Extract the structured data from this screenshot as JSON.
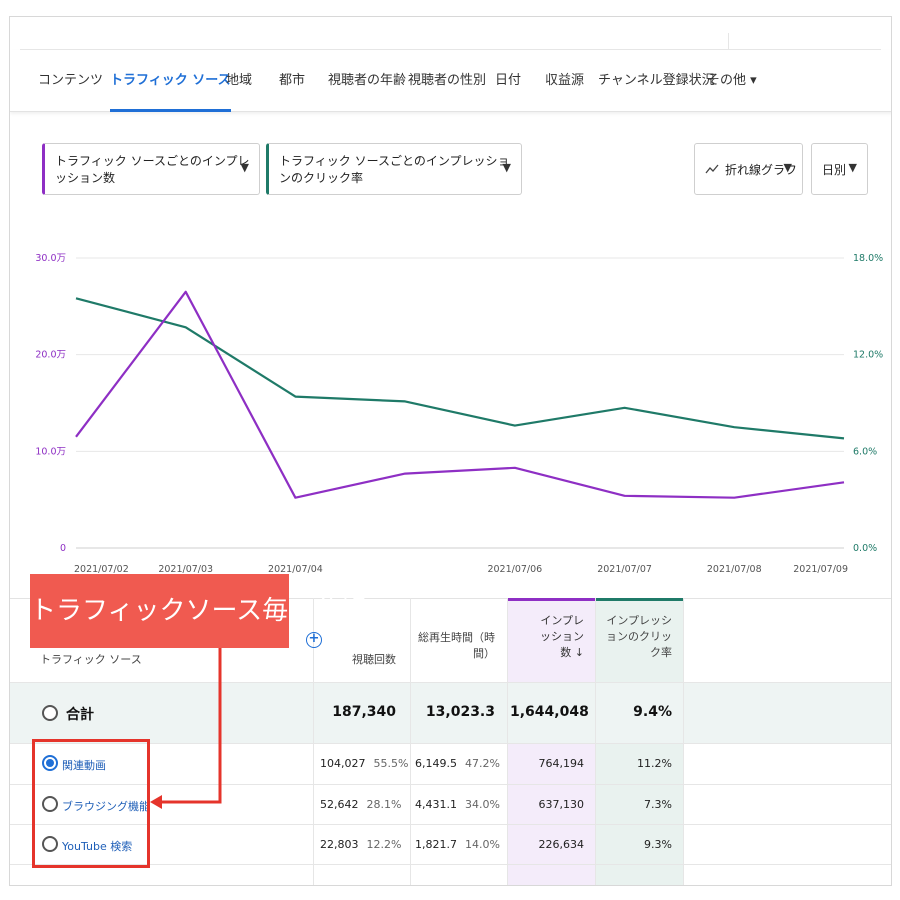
{
  "tabs": [
    {
      "label": "コンテンツ",
      "active": false
    },
    {
      "label": "トラフィック ソース",
      "active": true
    },
    {
      "label": "地域",
      "active": false
    },
    {
      "label": "都市",
      "active": false
    },
    {
      "label": "視聴者の年齢",
      "active": false
    },
    {
      "label": "視聴者の性別",
      "active": false
    },
    {
      "label": "日付",
      "active": false
    },
    {
      "label": "収益源",
      "active": false
    },
    {
      "label": "チャンネル登録状況",
      "active": false
    },
    {
      "label": "その他 ▾",
      "active": false
    }
  ],
  "selectors": {
    "metric1": "トラフィック ソースごとのインプレッション数",
    "metric2": "トラフィック ソースごとのインプレッションのクリック率",
    "chart_type": "折れ線グラフ",
    "period": "日別",
    "arrow": "▼"
  },
  "colors": {
    "series1": "#8e2fc4",
    "series2": "#1f7a68",
    "accent": "#1f6fd6",
    "annotation": "#f05a50"
  },
  "chart_data": {
    "type": "line",
    "x_labels": [
      "2021/07/02",
      "2021/07/03",
      "2021/07/04",
      "2021/07/06",
      "2021/07/07",
      "2021/07/08",
      "2021/07/09"
    ],
    "left_axis_ticks": [
      "0",
      "10.0万",
      "20.0万",
      "30.0万"
    ],
    "right_axis_ticks": [
      "0.0%",
      "6.0%",
      "12.0%",
      "18.0%"
    ],
    "left_ylim": [
      0,
      300000
    ],
    "right_ylim": [
      0,
      18
    ],
    "grid": true,
    "series": [
      {
        "axis": "left",
        "x": [
          "2021/07/02",
          "2021/07/03",
          "2021/07/04",
          "2021/07/05",
          "2021/07/06",
          "2021/07/07",
          "2021/07/08",
          "2021/07/09"
        ],
        "values": [
          115000,
          265000,
          52000,
          77000,
          83000,
          54000,
          52000,
          68000
        ]
      },
      {
        "axis": "right",
        "x": [
          "2021/07/02",
          "2021/07/03",
          "2021/07/04",
          "2021/07/05",
          "2021/07/06",
          "2021/07/07",
          "2021/07/08",
          "2021/07/09"
        ],
        "values": [
          15.5,
          13.7,
          9.4,
          9.1,
          7.6,
          8.7,
          7.5,
          6.8
        ]
      }
    ]
  },
  "table": {
    "header_source": "トラフィック ソース",
    "header_views": "視聴回数",
    "header_watch_1": "総再生時間（時",
    "header_watch_2": "間）",
    "header_imp_1": "インプレ",
    "header_imp_2": "ッション",
    "header_imp_3": "数 ↓",
    "header_ctr_1": "インプレッシ",
    "header_ctr_2": "ョンのクリッ",
    "header_ctr_3": "ク率",
    "plus": "+",
    "total": {
      "label": "合計",
      "views": "187,340",
      "watch": "13,023.3",
      "impressions": "1,644,048",
      "ctr": "9.4%"
    },
    "rows": [
      {
        "label": "関連動画",
        "selected": true,
        "views": "104,027",
        "views_pct": "55.5%",
        "watch": "6,149.5",
        "watch_pct": "47.2%",
        "impressions": "764,194",
        "ctr": "11.2%"
      },
      {
        "label": "ブラウジング機能",
        "selected": false,
        "views": "52,642",
        "views_pct": "28.1%",
        "watch": "4,431.1",
        "watch_pct": "34.0%",
        "impressions": "637,130",
        "ctr": "7.3%"
      },
      {
        "label": "YouTube 検索",
        "selected": false,
        "views": "22,803",
        "views_pct": "12.2%",
        "watch": "1,821.7",
        "watch_pct": "14.0%",
        "impressions": "226,634",
        "ctr": "9.3%"
      }
    ]
  },
  "annotation": {
    "banner": "トラフィックソース毎に分解"
  }
}
